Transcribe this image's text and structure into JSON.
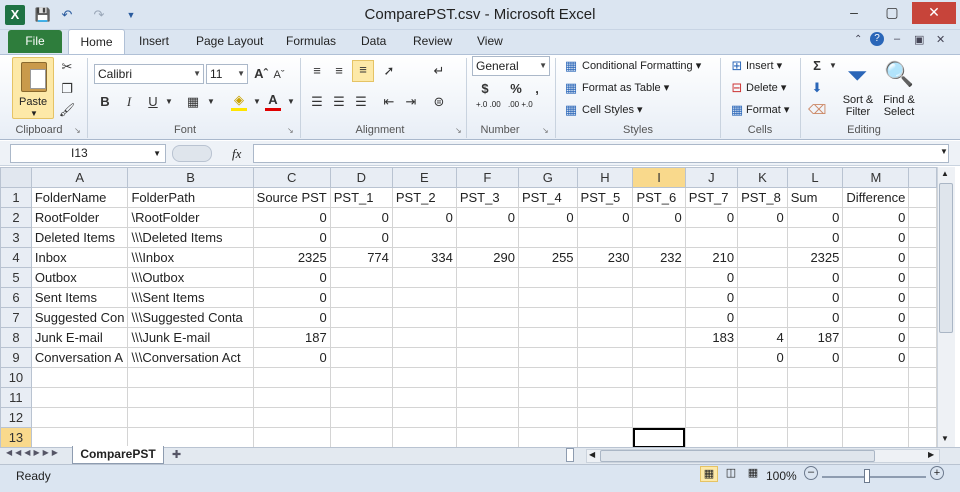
{
  "window": {
    "title": "ComparePST.csv - Microsoft Excel",
    "app_icon_letter": "X"
  },
  "ribbon": {
    "file_tab": "File",
    "tabs": [
      "Home",
      "Insert",
      "Page Layout",
      "Formulas",
      "Data",
      "Review",
      "View"
    ],
    "clipboard": {
      "paste": "Paste",
      "label": "Clipboard"
    },
    "font": {
      "name": "Calibri",
      "size": "11",
      "label": "Font"
    },
    "alignment": {
      "label": "Alignment"
    },
    "number": {
      "format": "General",
      "label": "Number",
      "currency": "$",
      "percent": "%",
      "comma": ",",
      "inc_decimal": "+.0 .00",
      "dec_decimal": ".00 +.0"
    },
    "styles": {
      "conditional": "Conditional Formatting",
      "format_table": "Format as Table",
      "cell_styles": "Cell Styles",
      "label": "Styles"
    },
    "cells": {
      "insert": "Insert",
      "delete": "Delete",
      "format": "Format",
      "label": "Cells"
    },
    "editing": {
      "sum_icon": "Σ",
      "sort_filter": "Sort & Filter",
      "find_select": "Find & Select",
      "label": "Editing"
    }
  },
  "formula_bar": {
    "name_box": "I13",
    "fx_label": "fx",
    "value": ""
  },
  "sheet": {
    "columns": [
      "A",
      "B",
      "C",
      "D",
      "E",
      "F",
      "G",
      "H",
      "I",
      "J",
      "K",
      "L",
      "M"
    ],
    "selected_column": "I",
    "selected_row": 13,
    "rows": [
      {
        "n": "1",
        "cells": [
          "FolderName",
          "FolderPath",
          "Source PST",
          "PST_1",
          "PST_2",
          "PST_3",
          "PST_4",
          "PST_5",
          "PST_6",
          "PST_7",
          "PST_8",
          "Sum",
          "Difference"
        ]
      },
      {
        "n": "2",
        "cells": [
          "RootFolder",
          "\\RootFolder",
          "0",
          "0",
          "0",
          "0",
          "0",
          "0",
          "0",
          "0",
          "0",
          "0",
          "0"
        ]
      },
      {
        "n": "3",
        "cells": [
          "Deleted Items",
          "\\\\\\Deleted Items",
          "0",
          "0",
          "",
          "",
          "",
          "",
          "",
          "",
          "",
          "0",
          "0"
        ]
      },
      {
        "n": "4",
        "cells": [
          "Inbox",
          "\\\\\\Inbox",
          "2325",
          "774",
          "334",
          "290",
          "255",
          "230",
          "232",
          "210",
          "",
          "2325",
          "0"
        ]
      },
      {
        "n": "5",
        "cells": [
          "Outbox",
          "\\\\\\Outbox",
          "0",
          "",
          "",
          "",
          "",
          "",
          "",
          "0",
          "",
          "0",
          "0"
        ]
      },
      {
        "n": "6",
        "cells": [
          "Sent Items",
          "\\\\\\Sent Items",
          "0",
          "",
          "",
          "",
          "",
          "",
          "",
          "0",
          "",
          "0",
          "0"
        ]
      },
      {
        "n": "7",
        "cells": [
          "Suggested Con",
          "\\\\\\Suggested Conta",
          "0",
          "",
          "",
          "",
          "",
          "",
          "",
          "0",
          "",
          "0",
          "0"
        ]
      },
      {
        "n": "8",
        "cells": [
          "Junk E-mail",
          "\\\\\\Junk E-mail",
          "187",
          "",
          "",
          "",
          "",
          "",
          "",
          "183",
          "4",
          "187",
          "0"
        ]
      },
      {
        "n": "9",
        "cells": [
          "Conversation A",
          "\\\\\\Conversation Act",
          "0",
          "",
          "",
          "",
          "",
          "",
          "",
          "",
          "0",
          "0",
          "0"
        ]
      },
      {
        "n": "10",
        "cells": [
          "",
          "",
          "",
          "",
          "",
          "",
          "",
          "",
          "",
          "",
          "",
          "",
          ""
        ]
      },
      {
        "n": "11",
        "cells": [
          "",
          "",
          "",
          "",
          "",
          "",
          "",
          "",
          "",
          "",
          "",
          "",
          ""
        ]
      },
      {
        "n": "12",
        "cells": [
          "",
          "",
          "",
          "",
          "",
          "",
          "",
          "",
          "",
          "",
          "",
          "",
          ""
        ]
      },
      {
        "n": "13",
        "cells": [
          "",
          "",
          "",
          "",
          "",
          "",
          "",
          "",
          "",
          "",
          "",
          "",
          ""
        ]
      }
    ],
    "tab_name": "ComparePST"
  },
  "status": {
    "ready": "Ready",
    "zoom": "100%"
  }
}
